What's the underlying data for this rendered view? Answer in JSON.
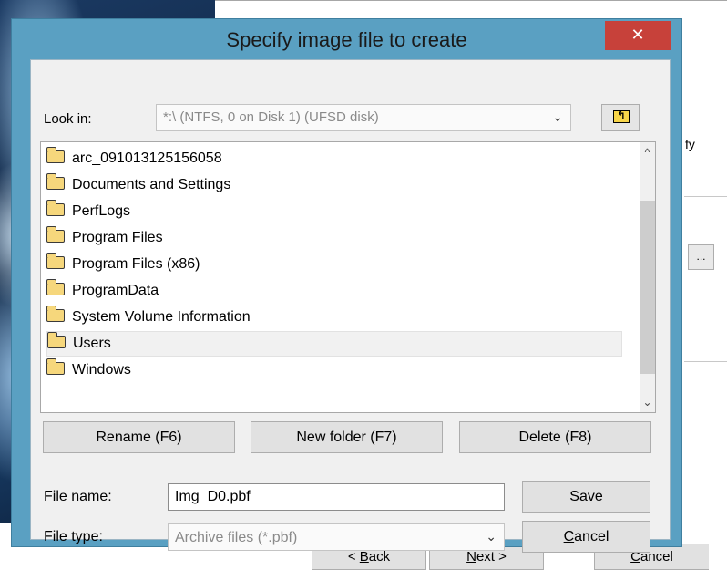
{
  "dialog": {
    "title": "Specify image file to create",
    "close_glyph": "✕",
    "look_in": {
      "label": "Look in:",
      "value": "*:\\ (NTFS, 0 on Disk 1) (UFSD disk)",
      "arrow": "⌄"
    },
    "up_button_icon": "up-folder-icon",
    "files": [
      {
        "name": "arc_091013125156058",
        "icon": "folder-icon"
      },
      {
        "name": "Documents and Settings",
        "icon": "folder-icon"
      },
      {
        "name": "PerfLogs",
        "icon": "folder-icon"
      },
      {
        "name": "Program Files",
        "icon": "folder-icon"
      },
      {
        "name": "Program Files (x86)",
        "icon": "folder-icon"
      },
      {
        "name": "ProgramData",
        "icon": "folder-icon"
      },
      {
        "name": "System Volume Information",
        "icon": "folder-icon"
      },
      {
        "name": "Users",
        "icon": "folder-icon",
        "selected": true
      },
      {
        "name": "Windows",
        "icon": "folder-icon"
      }
    ],
    "scroll_up": "^",
    "scroll_down": "⌄",
    "actions": {
      "rename": "Rename (F6)",
      "new_folder": "New folder (F7)",
      "delete": "Delete (F8)"
    },
    "file_name": {
      "label": "File name:",
      "value": "Img_D0.pbf"
    },
    "file_type": {
      "label": "File type:",
      "value": "Archive files (*.pbf)",
      "arrow": "⌄"
    },
    "save": "Save",
    "cancel_first": "C",
    "cancel_rest": "ancel"
  },
  "wizard": {
    "partial_text": "fy",
    "browse_label": "...",
    "back_prefix": "< ",
    "back_first": "B",
    "back_rest": "ack",
    "next_first": "N",
    "next_rest": "ext >",
    "cancel_first": "C",
    "cancel_rest": "ancel"
  },
  "colors": {
    "dialog_frame": "#5aa0c2",
    "close_button": "#c7413a",
    "up_folder": "#f7d54a"
  }
}
